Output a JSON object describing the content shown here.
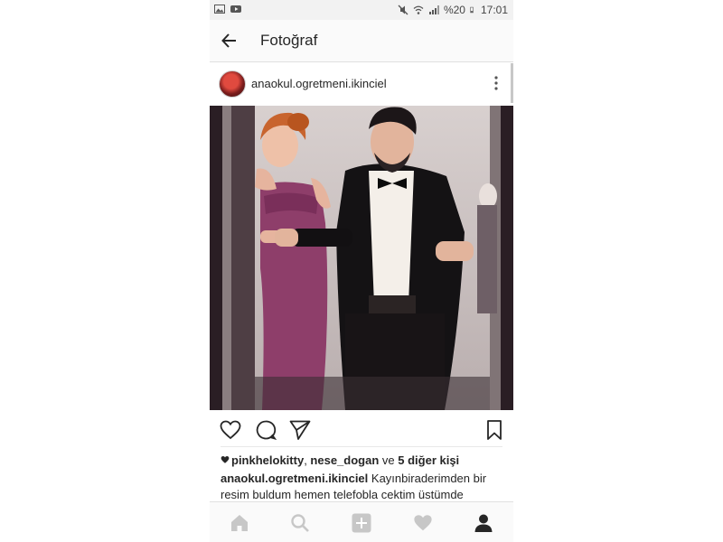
{
  "status_bar": {
    "battery": "%20",
    "time": "17:01",
    "left_icons": [
      "image-icon",
      "youtube-icon"
    ],
    "right_icons": [
      "mute-icon",
      "wifi-icon",
      "signal-icon",
      "battery-icon"
    ]
  },
  "header": {
    "title": "Fotoğraf"
  },
  "post": {
    "username": "anaokul.ogretmeni.ikinciel",
    "likes": {
      "user1": "pinkhelokitty",
      "sep": ", ",
      "user2": "nese_dogan",
      "and": " ve ",
      "others": "5 diğer kişi"
    },
    "caption": {
      "username": "anaokul.ogretmeni.ikinciel",
      "text": " Kayınbiraderimden bir resim buldum hemen telefobla cektim üstümde"
    }
  },
  "colors": {
    "text": "#262626",
    "inactive_icon": "#c7c7c7",
    "dress": "#8e3e6a"
  }
}
